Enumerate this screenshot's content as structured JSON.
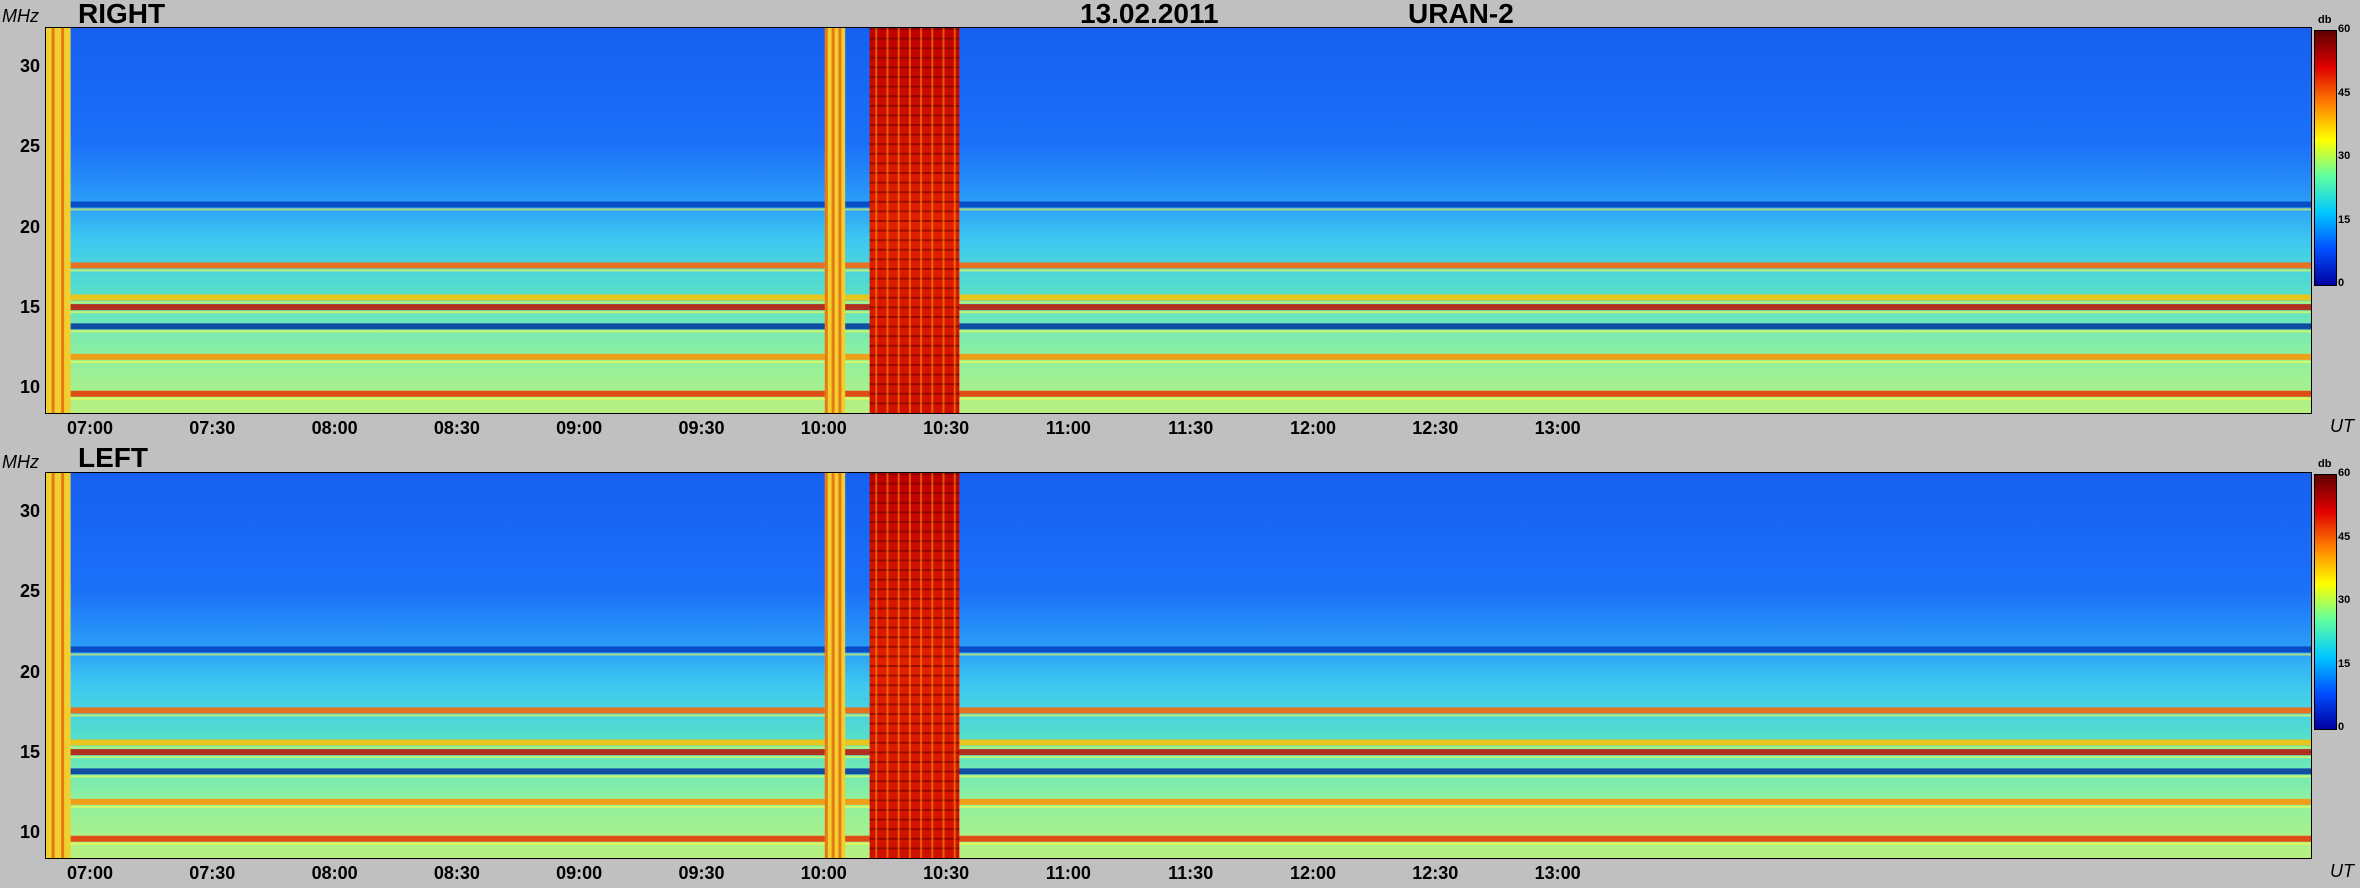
{
  "header": {
    "date": "13.02.2011",
    "instrument": "URAN-2"
  },
  "colors": {
    "background": "#c0c0c0",
    "colormap": [
      "#0000a0",
      "#0050ff",
      "#00c8ff",
      "#60ffa0",
      "#ffff00",
      "#ff8000",
      "#e00000",
      "#600000"
    ]
  },
  "chart_data": [
    {
      "type": "heatmap",
      "title": "RIGHT",
      "xlabel": "UT",
      "ylabel": "MHz",
      "x_tick_labels": [
        "07:00",
        "07:30",
        "08:00",
        "08:30",
        "09:00",
        "09:30",
        "10:00",
        "10:30",
        "11:00",
        "11:30",
        "12:00",
        "12:30",
        "13:00"
      ],
      "y_ticks": [
        10,
        15,
        20,
        25,
        30
      ],
      "ylim": [
        8.5,
        32.5
      ],
      "colorbar": {
        "unit": "db",
        "ticks": [
          0,
          15,
          30,
          45,
          60
        ],
        "range": [
          0,
          60
        ]
      },
      "features": {
        "band_freqs_mhz": [
          9.7,
          12.0,
          13.9,
          15.1,
          15.7,
          17.7,
          21.5
        ],
        "burst_intervals": [
          [
            "06:48",
            "06:55"
          ],
          [
            "10:00",
            "10:05"
          ],
          [
            "10:11",
            "10:33"
          ]
        ]
      }
    },
    {
      "type": "heatmap",
      "title": "LEFT",
      "xlabel": "UT",
      "ylabel": "MHz",
      "x_tick_labels": [
        "07:00",
        "07:30",
        "08:00",
        "08:30",
        "09:00",
        "09:30",
        "10:00",
        "10:30",
        "11:00",
        "11:30",
        "12:00",
        "12:30",
        "13:00"
      ],
      "y_ticks": [
        10,
        15,
        20,
        25,
        30
      ],
      "ylim": [
        8.5,
        32.5
      ],
      "colorbar": {
        "unit": "db",
        "ticks": [
          0,
          15,
          30,
          45,
          60
        ],
        "range": [
          0,
          60
        ]
      },
      "features": {
        "band_freqs_mhz": [
          9.7,
          12.0,
          13.9,
          15.1,
          15.7,
          17.7,
          21.5
        ],
        "burst_intervals": [
          [
            "06:48",
            "06:55"
          ],
          [
            "10:00",
            "10:05"
          ],
          [
            "10:11",
            "10:33"
          ]
        ]
      }
    }
  ]
}
